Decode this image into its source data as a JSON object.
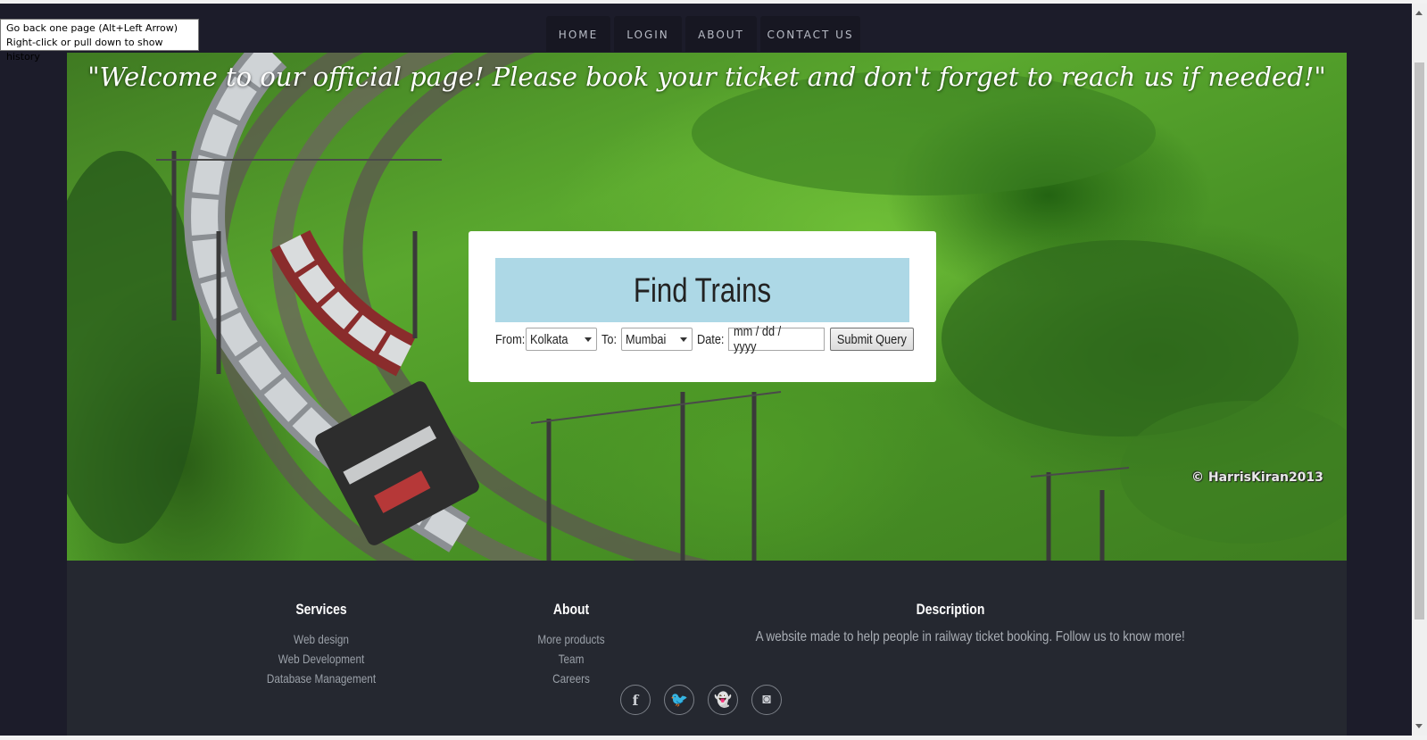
{
  "nav": {
    "items": [
      {
        "label": "HOME"
      },
      {
        "label": "LOGIN"
      },
      {
        "label": "ABOUT"
      },
      {
        "label": "CONTACT US"
      }
    ]
  },
  "hero": {
    "welcome": "\"Welcome to our official page! Please book your ticket and don't forget to reach us if needed!\"",
    "watermark": "© HarrisKiran2013"
  },
  "search": {
    "title": "Find Trains",
    "from_label": "From:",
    "from_value": "Kolkata",
    "to_label": "To:",
    "to_value": "Mumbai",
    "date_label": "Date:",
    "date_placeholder": "mm / dd / yyyy",
    "submit_label": "Submit Query"
  },
  "footer": {
    "services": {
      "heading": "Services",
      "links": [
        "Web design",
        "Web Development",
        "Database Management"
      ]
    },
    "about": {
      "heading": "About",
      "links": [
        "More products",
        "Team",
        "Careers"
      ]
    },
    "description": {
      "heading": "Description",
      "text": "A website made to help people in railway ticket booking. Follow us to know more!"
    },
    "socials": [
      {
        "icon": "facebook-icon",
        "glyph": "f"
      },
      {
        "icon": "twitter-icon",
        "glyph": "🐦"
      },
      {
        "icon": "snapchat-icon",
        "glyph": "👻"
      },
      {
        "icon": "instagram-icon",
        "glyph": "◙"
      }
    ]
  },
  "tooltip": {
    "line1": "Go back one page (Alt+Left Arrow)",
    "line2": "Right-click or pull down to show history"
  },
  "colors": {
    "page_bg": "#1c1c2a",
    "nav_bg": "#171722",
    "card_header": "#add8e6",
    "footer_bg": "#252830"
  }
}
